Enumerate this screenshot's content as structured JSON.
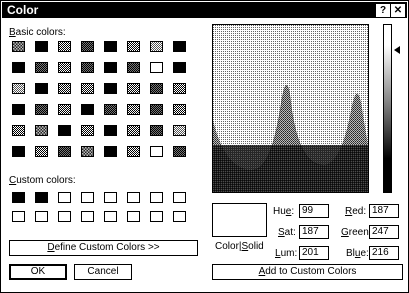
{
  "window": {
    "title": "Color",
    "help_label": "?",
    "close_label": "✕"
  },
  "basic": {
    "label_mnemonic": "B",
    "label_rest": "asic colors:",
    "grid": [
      [
        "d4",
        "black",
        "d1",
        "d2",
        "black",
        "d1",
        "d3",
        "black"
      ],
      [
        "black",
        "d2",
        "d1",
        "d2",
        "black",
        "d2",
        "white",
        "black"
      ],
      [
        "d3",
        "black",
        "d1",
        "d1",
        "black",
        "d1",
        "d2",
        "d1"
      ],
      [
        "black",
        "d2",
        "d1",
        "black",
        "d2",
        "d1",
        "d2",
        "d1"
      ],
      [
        "d1",
        "d4",
        "black",
        "d1",
        "black",
        "d1",
        "d2",
        "d3"
      ],
      [
        "black",
        "d1",
        "d2",
        "d4",
        "black",
        "d1",
        "white",
        "d2"
      ]
    ]
  },
  "custom": {
    "label_mnemonic": "C",
    "label_rest": "ustom colors:",
    "grid": [
      [
        "black",
        "black",
        "white",
        "white",
        "white",
        "white",
        "white",
        "white"
      ],
      [
        "white",
        "white",
        "white",
        "white",
        "white",
        "white",
        "white",
        "white"
      ]
    ]
  },
  "buttons": {
    "define": {
      "mnemonic": "D",
      "rest": "efine Custom Colors >>"
    },
    "ok": "OK",
    "cancel": "Cancel",
    "add": {
      "mnemonic": "A",
      "rest": "dd to Custom Colors"
    }
  },
  "preview": {
    "label_pre": "Color|",
    "mnemonic": "S",
    "label_rest": "olid"
  },
  "fields": {
    "hue": {
      "label_pre": "Hu",
      "mnemonic": "e",
      "label_rest": ":",
      "value": "99"
    },
    "sat": {
      "label_pre": "",
      "mnemonic": "S",
      "label_rest": "at:",
      "value": "187"
    },
    "lum": {
      "label_pre": "",
      "mnemonic": "L",
      "label_rest": "um:",
      "value": "201"
    },
    "red": {
      "label_pre": "",
      "mnemonic": "R",
      "label_rest": "ed:",
      "value": "187"
    },
    "green": {
      "label_pre": "",
      "mnemonic": "G",
      "label_rest": "reen:",
      "value": "247"
    },
    "blue": {
      "label_pre": "Bl",
      "mnemonic": "u",
      "label_rest": "e:",
      "value": "216"
    }
  }
}
